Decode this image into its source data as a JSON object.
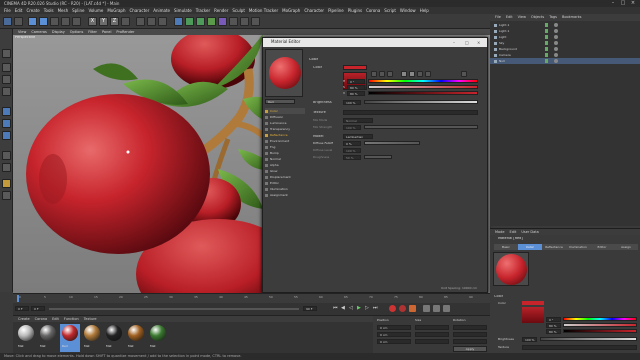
{
  "app": {
    "title": "CINEMA 4D R20.026 Studio (RC - R20) - [LAT.c4d *] - Main"
  },
  "menu": [
    "File",
    "Edit",
    "Create",
    "Tools",
    "Mesh",
    "Spline",
    "Volume",
    "MoGraph",
    "Character",
    "Animate",
    "Simulate",
    "Tracker",
    "Render",
    "Sculpt",
    "Motion Tracker",
    "MoGraph",
    "Character",
    "Pipeline",
    "Plugins",
    "Corona",
    "Script",
    "Window",
    "Help"
  ],
  "viewport": {
    "menu": [
      "View",
      "Cameras",
      "Display",
      "Options",
      "Filter",
      "Panel",
      "ProRender"
    ],
    "label": "Perspective"
  },
  "material_editor": {
    "title": "Material Editor",
    "material_name": "Red",
    "channels": [
      {
        "name": "Color",
        "on": true
      },
      {
        "name": "Diffusion",
        "on": false
      },
      {
        "name": "Luminance",
        "on": false
      },
      {
        "name": "Transparency",
        "on": false
      },
      {
        "name": "Reflectance",
        "on": true
      },
      {
        "name": "Environment",
        "on": false
      },
      {
        "name": "Fog",
        "on": false
      },
      {
        "name": "Bump",
        "on": false
      },
      {
        "name": "Normal",
        "on": false
      },
      {
        "name": "Alpha",
        "on": false
      },
      {
        "name": "Glow",
        "on": false
      },
      {
        "name": "Displacement",
        "on": false
      },
      {
        "name": "Editor",
        "on": false
      },
      {
        "name": "Illumination",
        "on": false
      },
      {
        "name": "Assignment",
        "on": false
      }
    ],
    "section": "Color",
    "color_label": "Color",
    "h_label": "H",
    "s_label": "S",
    "v_label": "V",
    "h_value": "0 °",
    "s_value": "80 %",
    "v_value": "80 %",
    "brightness_label": "Brightness",
    "brightness_value": "100 %",
    "texture_label": "Texture",
    "mix_mode_label": "Mix Mode",
    "mix_mode_value": "Normal",
    "mix_strength_label": "Mix Strength",
    "mix_strength_value": "100 %",
    "model_label": "Model",
    "model_value": "Lambertian",
    "diffuse_falloff_label": "Diffuse Falloff",
    "diffuse_falloff_value": "0 %",
    "diffuse_level_label": "Diffuse Level",
    "diffuse_level_value": "100 %",
    "roughness_label": "Roughness",
    "roughness_value": "50 %",
    "footer": "Unit Spacing: 10000 cm"
  },
  "object_manager": {
    "menu": [
      "File",
      "Edit",
      "View",
      "Objects",
      "Tags",
      "Bookmarks"
    ],
    "objects": [
      "Light.1",
      "Light.1",
      "Light",
      "Sky",
      "Background",
      "Camera",
      "Null"
    ]
  },
  "attributes": {
    "menu": [
      "Mode",
      "Edit",
      "User Data"
    ],
    "material_title": "Material [Red]",
    "tabs": [
      "Basic",
      "Color",
      "Reflectance",
      "Illumination",
      "Editor",
      "Assign"
    ],
    "section": "Color",
    "color_label": "Color",
    "h_label": "H",
    "s_label": "S",
    "v_label": "V",
    "h_value": "0 °",
    "s_value": "80 %",
    "v_value": "80 %",
    "brightness_label": "Brightness",
    "brightness_value": "100 %",
    "texture_label": "Texture"
  },
  "timeline": {
    "start": "0 F",
    "end": "90 F",
    "current": "0 F",
    "ticks": [
      "0",
      "5",
      "10",
      "15",
      "20",
      "25",
      "30",
      "35",
      "40",
      "45",
      "50",
      "55",
      "60",
      "65",
      "70",
      "75",
      "80",
      "85",
      "90"
    ]
  },
  "material_manager": {
    "menu": [
      "Create",
      "Corona",
      "Edit",
      "Function",
      "Texture"
    ],
    "materials": [
      {
        "name": "Mat",
        "color": "#bbbbbb"
      },
      {
        "name": "Mat",
        "color": "#666666"
      },
      {
        "name": "Red",
        "color": "#c0282c"
      },
      {
        "name": "Mat",
        "color": "#b07a3a"
      },
      {
        "name": "Mat",
        "color": "#222222"
      },
      {
        "name": "Mat",
        "color": "#a06020"
      },
      {
        "name": "Mat",
        "color": "#3a7a30"
      }
    ]
  },
  "coordinates": {
    "position_label": "Position",
    "size_label": "Size",
    "rotation_label": "Rotation",
    "x": "0 cm",
    "y": "0 cm",
    "z": "0 cm",
    "apply_label": "Apply"
  },
  "status": "Move: Click and drag to move elements. Hold down SHIFT to quantize movement / add to the selection in point mode, CTRL to remove.",
  "colors": {
    "accent": "#5b8fd6",
    "apple_red": "#c7242c",
    "leaf_green": "#4f8a2a",
    "stem": "#b07a3a"
  }
}
